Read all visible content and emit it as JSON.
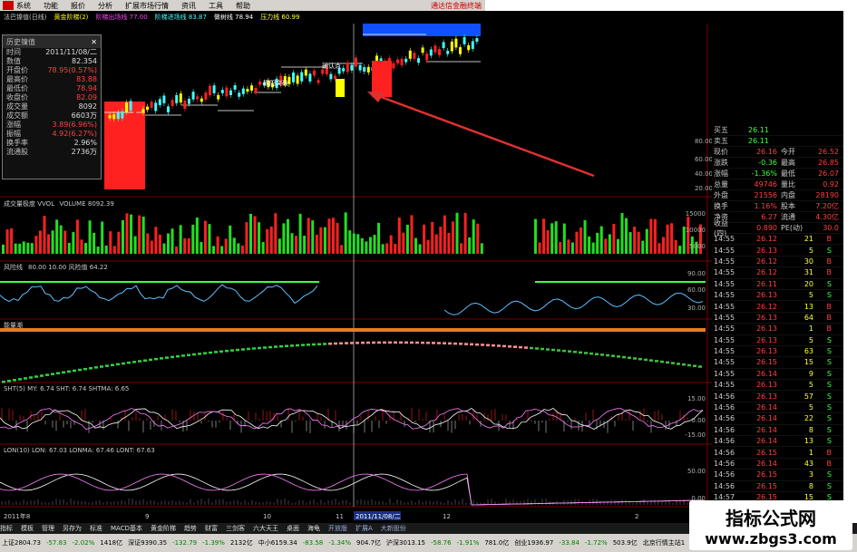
{
  "menu": {
    "items": [
      "系统",
      "功能",
      "报价",
      "分析",
      "扩展市场行情",
      "资讯",
      "工具",
      "帮助"
    ],
    "brand": "通达信金融终端"
  },
  "main_chart": {
    "title_items": [
      "法巴镍值(日线)",
      "黄金阶梯(2)",
      "阶梯出场线 77.00",
      "阶梯进场线 83.87",
      "做树线 78.94",
      "压力线 60.99"
    ],
    "annotations": [
      "摘阳突破",
      "确认点"
    ]
  },
  "popup": {
    "title": "历史镍值",
    "close": "✕",
    "rows": [
      {
        "label": "时间",
        "value": "2011/11/08/二"
      },
      {
        "label": "数值",
        "value": "82.354"
      },
      {
        "label": "开盘价",
        "value": "78.95(0.57%)"
      },
      {
        "label": "最高价",
        "value": "83.88"
      },
      {
        "label": "最低价",
        "value": "78.94"
      },
      {
        "label": "收盘价",
        "value": "82.09"
      },
      {
        "label": "成交量",
        "value": "8092"
      },
      {
        "label": "成交额",
        "value": "6603万"
      },
      {
        "label": "涨幅",
        "value": "3.89(6.96%)"
      },
      {
        "label": "振幅",
        "value": "4.92(6.27%)"
      },
      {
        "label": "换手率",
        "value": "2.96%"
      },
      {
        "label": "流通股",
        "value": "2736万"
      }
    ]
  },
  "panels": {
    "volume_title": "成交量极度 VVOL",
    "volume_value": "VOLUME 8092.39",
    "p3_title": "风险线",
    "p3_values": "80.00 10.00 风险值 64.22",
    "p4_title": "能量潮",
    "p5_title": "SHT(5) MY: 6.74 SHT: 6.74 SHTMA: 6.65",
    "p6_title": "LON(10) LON: 67.03 LONMA: 67.46 LONT: 67.63"
  },
  "axis": {
    "price_labels": [
      "80.00",
      "60.00",
      "40.00",
      "20.00"
    ],
    "volume_labels": [
      "15000",
      "10000",
      "5000"
    ],
    "p3_labels": [
      "90.00",
      "60.00",
      "30.00"
    ],
    "p5_labels": [
      "15.00",
      "0.00",
      "-15.00"
    ],
    "p6_labels": [
      "50.00",
      "0.00"
    ],
    "date_labels": [
      "2011年8",
      "9",
      "10",
      "11",
      "2011/11/08/二",
      "12",
      "2"
    ]
  },
  "quote": {
    "top": [
      {
        "label": "买五",
        "value": "26.11"
      },
      {
        "label": "卖五",
        "value": "26.11"
      }
    ],
    "stats": [
      {
        "l1": "现价",
        "v1": "26.16",
        "l2": "今开",
        "v2": "26.52"
      },
      {
        "l1": "涨跌",
        "v1": "-0.36",
        "l2": "最高",
        "v2": "26.85"
      },
      {
        "l1": "涨幅",
        "v1": "-1.36%",
        "l2": "最低",
        "v2": "26.07"
      },
      {
        "l1": "总量",
        "v1": "49746",
        "l2": "量比",
        "v2": "0.92"
      },
      {
        "l1": "外盘",
        "v1": "21556",
        "l2": "内盘",
        "v2": "28190"
      },
      {
        "l1": "换手",
        "v1": "1.16%",
        "l2": "股本",
        "v2": "7.20亿"
      },
      {
        "l1": "净资",
        "v1": "6.27",
        "l2": "流通",
        "v2": "4.30亿"
      },
      {
        "l1": "收益(四)",
        "v1": "0.890",
        "l2": "PE(动)",
        "v2": "30.0"
      }
    ],
    "ticks": [
      {
        "t": "14:55",
        "p": "26.12",
        "v": "21",
        "f": "B"
      },
      {
        "t": "14:55",
        "p": "26.13",
        "v": "5",
        "f": "S"
      },
      {
        "t": "14:55",
        "p": "26.12",
        "v": "30",
        "f": "B"
      },
      {
        "t": "14:55",
        "p": "26.12",
        "v": "31",
        "f": "B"
      },
      {
        "t": "14:55",
        "p": "26.11",
        "v": "20",
        "f": "S"
      },
      {
        "t": "14:55",
        "p": "26.13",
        "v": "5",
        "f": "S"
      },
      {
        "t": "14:55",
        "p": "26.12",
        "v": "13",
        "f": "B"
      },
      {
        "t": "14:55",
        "p": "26.13",
        "v": "64",
        "f": "B"
      },
      {
        "t": "14:55",
        "p": "26.13",
        "v": "1",
        "f": "B"
      },
      {
        "t": "14:55",
        "p": "26.13",
        "v": "5",
        "f": "S"
      },
      {
        "t": "14:55",
        "p": "26.13",
        "v": "63",
        "f": "S"
      },
      {
        "t": "14:55",
        "p": "26.15",
        "v": "15",
        "f": "S"
      },
      {
        "t": "14:55",
        "p": "26.14",
        "v": "9",
        "f": "S"
      },
      {
        "t": "14:55",
        "p": "26.13",
        "v": "5",
        "f": "S"
      },
      {
        "t": "14:56",
        "p": "26.13",
        "v": "57",
        "f": "S"
      },
      {
        "t": "14:56",
        "p": "26.14",
        "v": "5",
        "f": "S"
      },
      {
        "t": "14:56",
        "p": "26.14",
        "v": "22",
        "f": "S"
      },
      {
        "t": "14:56",
        "p": "26.14",
        "v": "8",
        "f": "S"
      },
      {
        "t": "14:56",
        "p": "26.14",
        "v": "13",
        "f": "S"
      },
      {
        "t": "14:56",
        "p": "26.15",
        "v": "1",
        "f": "B"
      },
      {
        "t": "14:56",
        "p": "26.14",
        "v": "43",
        "f": "B"
      },
      {
        "t": "14:56",
        "p": "26.15",
        "v": "3",
        "f": "S"
      },
      {
        "t": "14:56",
        "p": "26.15",
        "v": "8",
        "f": "S"
      },
      {
        "t": "14:57",
        "p": "26.15",
        "v": "15",
        "f": "S"
      },
      {
        "t": "14:57",
        "p": "26.15",
        "v": "8",
        "f": "S"
      }
    ]
  },
  "tabs": [
    "指标",
    "模板",
    "管理",
    "另存为",
    "标准",
    "MACD基本",
    "黄金阶梯",
    "趋势",
    "财富",
    "三剑客",
    "六大天王",
    "桌面",
    "海龟"
  ],
  "tabs2": [
    "开放版",
    "扩展A",
    "大新股份"
  ],
  "ticker": [
    "上证2804.73",
    "-57.83",
    "-2.02%",
    "1418亿",
    "深证9390.35",
    "-132.79",
    "-1.39%",
    "2132亿",
    "中小6159.34",
    "-83.58",
    "-1.34%",
    "904.7亿",
    "沪深3013.15",
    "-58.76",
    "-1.91%",
    "781.0亿",
    "创业1936.97",
    "-33.84",
    "-1.72%",
    "503.9亿",
    "北京行情主站1"
  ],
  "watermark": {
    "line1": "指标公式网",
    "line2": "www.zbgs3.com"
  },
  "colors": {
    "up": "#ff2020",
    "down": "#20e020",
    "bg": "#000000",
    "yellow": "#ffff00",
    "blue": "#1050ff"
  }
}
